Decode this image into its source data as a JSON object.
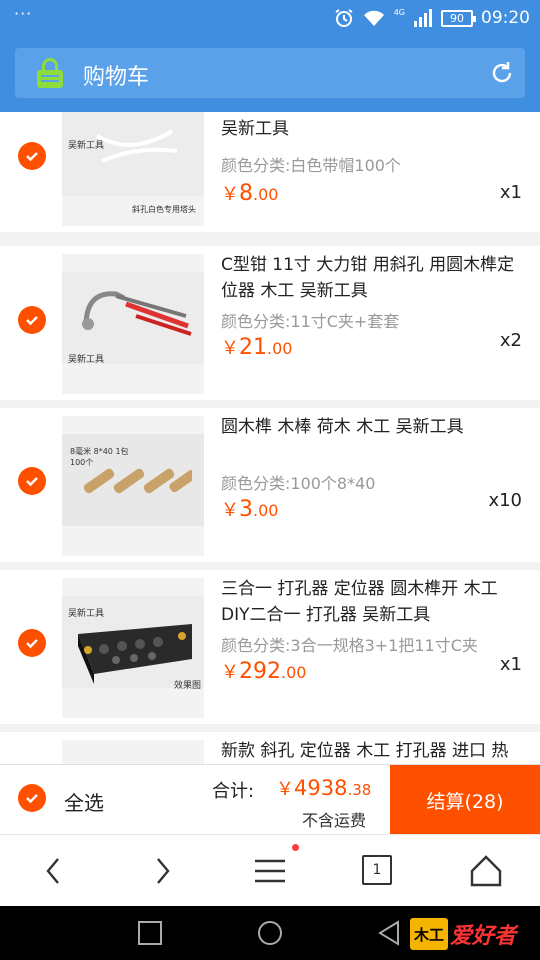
{
  "status_bar": {
    "dots": "···",
    "network": "4G",
    "battery": "90",
    "time": "09:20"
  },
  "header": {
    "title": "购物车"
  },
  "items": [
    {
      "title_line1": "吴新工具",
      "spec": "颜色分类:白色带帽100个",
      "price_currency": "￥",
      "price_int": "8",
      "price_dec": ".00",
      "qty": "x1",
      "thumb_caption": "斜孔白色专用塔头",
      "thumb_brand": "吴新工具"
    },
    {
      "title": "C型钳 11寸 大力钳 用斜孔 用圆木榫定位器 木工 吴新工具",
      "spec": "颜色分类:11寸C夹+套套",
      "price_currency": "￥",
      "price_int": "21",
      "price_dec": ".00",
      "qty": "x2",
      "thumb_brand": "吴新工具"
    },
    {
      "title": "圆木榫 木棒 荷木 木工 吴新工具",
      "spec": "颜色分类:100个8*40",
      "price_currency": "￥",
      "price_int": "3",
      "price_dec": ".00",
      "qty": "x10",
      "thumb_caption": "8毫米 8*40 1包100个"
    },
    {
      "title": "三合一 打孔器 定位器 圆木榫开 木工 DIY二合一 打孔器 吴新工具",
      "spec": "颜色分类:3合一规格3+1把11寸C夹",
      "price_currency": "￥",
      "price_int": "292",
      "price_dec": ".00",
      "qty": "x1",
      "thumb_brand": "吴新工具",
      "thumb_caption": "效果图"
    },
    {
      "title": "新款 斜孔 定位器 木工 打孔器 进口 热"
    }
  ],
  "footer": {
    "select_all": "全选",
    "sum_label": "合计:",
    "sum_currency": "￥",
    "sum_int": "4938",
    "sum_dec": ".38",
    "shipping_note": "不含运费",
    "checkout": "结算(28)"
  },
  "browser_nav": {
    "tab_count": "1"
  },
  "watermark": {
    "text": "爱好者"
  },
  "colors": {
    "accent": "#ff5000",
    "header": "#3f8ee0",
    "header_bar": "#5aa1ea"
  }
}
